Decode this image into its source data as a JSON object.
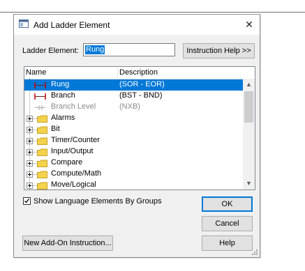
{
  "dialog": {
    "title": "Add Ladder Element",
    "close_glyph": "✕",
    "element_label": "Ladder Element:",
    "element_value": "Rung",
    "instruction_help": "Instruction Help >>",
    "columns": {
      "name": "Name",
      "description": "Description"
    },
    "rows": [
      {
        "name": "Rung",
        "desc": "(SOR - EOR)",
        "icon": "rung-icon",
        "state": "selected"
      },
      {
        "name": "Branch",
        "desc": "(BST - BND)",
        "icon": "branch-icon",
        "state": "normal"
      },
      {
        "name": "Branch Level",
        "desc": "(NXB)",
        "icon": "branch-level-icon",
        "state": "disabled"
      },
      {
        "name": "Alarms",
        "desc": "",
        "icon": "folder-icon",
        "state": "group"
      },
      {
        "name": "Bit",
        "desc": "",
        "icon": "folder-icon",
        "state": "group"
      },
      {
        "name": "Timer/Counter",
        "desc": "",
        "icon": "folder-icon",
        "state": "group"
      },
      {
        "name": "Input/Output",
        "desc": "",
        "icon": "folder-icon",
        "state": "group"
      },
      {
        "name": "Compare",
        "desc": "",
        "icon": "folder-icon",
        "state": "group"
      },
      {
        "name": "Compute/Math",
        "desc": "",
        "icon": "folder-icon",
        "state": "group"
      },
      {
        "name": "Move/Logical",
        "desc": "",
        "icon": "folder-icon",
        "state": "group"
      }
    ],
    "show_by_groups_label": "Show Language Elements By Groups",
    "show_by_groups_checked": true,
    "ok": "OK",
    "cancel": "Cancel",
    "new_aoi": "New Add-On Instruction...",
    "help": "Help"
  },
  "colors": {
    "selection": "#0078d7",
    "folder": "#f5d24e",
    "rung_red": "#c00000"
  }
}
